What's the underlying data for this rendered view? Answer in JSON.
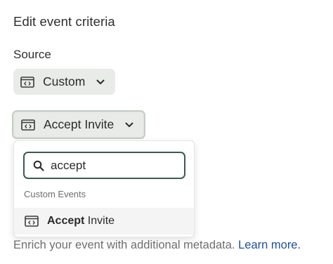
{
  "heading": "Edit event criteria",
  "source_label": "Source",
  "source_select": {
    "icon": "code-brackets-icon",
    "value": "Custom"
  },
  "event_select": {
    "icon": "code-brackets-icon",
    "value": "Accept Invite"
  },
  "dropdown": {
    "search": {
      "icon": "search-icon",
      "value": "accept",
      "placeholder": ""
    },
    "group_label": "Custom Events",
    "options": [
      {
        "icon": "code-brackets-icon",
        "match": "Accept",
        "rest": " Invite"
      }
    ]
  },
  "footer": {
    "text": "Enrich your event with additional metadata.",
    "link": "Learn more."
  },
  "colors": {
    "focus_border": "#3d5a4b",
    "pill_bg": "#e9ebe8",
    "link": "#1f4f9e"
  }
}
